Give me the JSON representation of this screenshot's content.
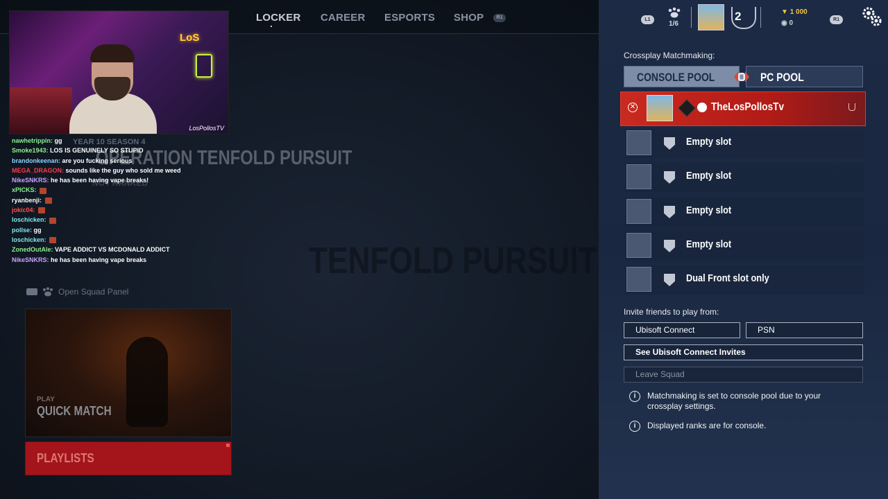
{
  "nav": {
    "items": [
      "LOCKER",
      "CAREER",
      "ESPORTS",
      "SHOP"
    ],
    "r1": "R1"
  },
  "game": {
    "season": "YEAR 10 SEASON 4",
    "operation": "OPERATION TENFOLD PURSUIT",
    "rank_status": "NOT RANKED",
    "ghost_title": "TENFOLD PURSUIT",
    "open_squad": "Open Squad Panel",
    "quick_match_sub": "PLAY",
    "quick_match": "QUICK MATCH",
    "playlists": "PLAYLISTS"
  },
  "webcam": {
    "neon": "LoS",
    "watermark": "LosPollosTV"
  },
  "chat": [
    {
      "user": "nawhetrippin:",
      "msg": "gg",
      "color": "#8ef08e",
      "emote": false
    },
    {
      "user": "Smoke1943:",
      "msg": "LOS IS GENUINELY SO STUPID",
      "color": "#8ef08e",
      "emote": false
    },
    {
      "user": "brandonkeenan:",
      "msg": "are you fucking serious",
      "color": "#8fd3ff",
      "emote": false
    },
    {
      "user": "MEGA_DRAGON:",
      "msg": "sounds like the guy who sold me weed",
      "color": "#ff3a4a",
      "emote": false
    },
    {
      "user": "NikeSNKRS:",
      "msg": "he has been having vape breaks!",
      "color": "#c8a2ff",
      "emote": false
    },
    {
      "user": "xPICKS:",
      "msg": "",
      "color": "#8ef08e",
      "emote": true
    },
    {
      "user": "ryanbenji:",
      "msg": "",
      "color": "#ffffff",
      "emote": true
    },
    {
      "user": "jokic04:",
      "msg": "",
      "color": "#ff4d4d",
      "emote": true
    },
    {
      "user": "loschicken:",
      "msg": "",
      "color": "#7fe8e8",
      "emote": true
    },
    {
      "user": "pollse:",
      "msg": "gg",
      "color": "#7fe8e8",
      "emote": false
    },
    {
      "user": "loschicken:",
      "msg": "",
      "color": "#7fe8e8",
      "emote": true
    },
    {
      "user": "ZonedOutAle:",
      "msg": "VAPE ADDICT VS MCDONALD ADDICT",
      "color": "#8ef08e",
      "emote": false
    },
    {
      "user": "NikeSNKRS:",
      "msg": "he has been having vape breaks",
      "color": "#c8a2ff",
      "emote": false
    }
  ],
  "header": {
    "l1": "L1",
    "squad_count": "1/6",
    "level": "2",
    "credits": "1 000",
    "renown": "0",
    "r1": "R1"
  },
  "panel": {
    "crossplay_label": "Crossplay Matchmaking:",
    "console_pool": "CONSOLE POOL",
    "pc_pool": "PC POOL",
    "player_name": "TheLosPollosTv",
    "slots": [
      "Empty slot",
      "Empty slot",
      "Empty slot",
      "Empty slot",
      "Dual Front slot only"
    ],
    "invite_label": "Invite friends to play from:",
    "ubisoft_connect": "Ubisoft Connect",
    "psn": "PSN",
    "see_invites": "See Ubisoft Connect Invites",
    "leave_squad": "Leave Squad",
    "info1": "Matchmaking is set to console pool due to your crossplay settings.",
    "info2": "Displayed ranks are for console."
  },
  "colors": {
    "accent_red": "#c92a20",
    "panel_bg": "#1c2a45",
    "credits_gold": "#f2c744"
  }
}
